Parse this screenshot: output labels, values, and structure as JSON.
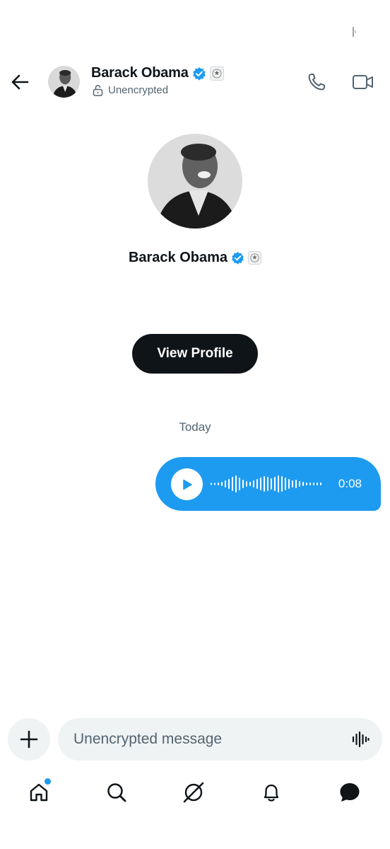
{
  "colors": {
    "accent": "#1d9bf0",
    "text_primary": "#0f1419",
    "text_secondary": "#536471",
    "input_background": "#eff3f4"
  },
  "header": {
    "back_icon": "arrow-left-icon",
    "contact_name": "Barack Obama",
    "verified_icon": "verified-badge-icon",
    "affiliation_icon": "government-seal-icon",
    "encryption_status": "Unencrypted",
    "encryption_icon": "unlocked-padlock-icon",
    "call_icon": "phone-icon",
    "video_icon": "video-camera-icon"
  },
  "profile": {
    "name": "Barack Obama",
    "view_profile_label": "View Profile"
  },
  "conversation": {
    "date_divider": "Today",
    "messages": [
      {
        "type": "voice",
        "direction": "outgoing",
        "duration": "0:08",
        "play_icon": "play-icon"
      }
    ]
  },
  "composer": {
    "add_icon": "plus-icon",
    "placeholder": "Unencrypted message",
    "voice_icon": "audio-waveform-icon"
  },
  "tab_bar": {
    "tabs": [
      {
        "name": "home",
        "icon": "home-icon",
        "has_notification_dot": true
      },
      {
        "name": "search",
        "icon": "search-icon"
      },
      {
        "name": "grok",
        "icon": "grok-icon"
      },
      {
        "name": "notifications",
        "icon": "bell-icon"
      },
      {
        "name": "messages",
        "icon": "chat-bubble-icon",
        "active": true
      }
    ]
  }
}
